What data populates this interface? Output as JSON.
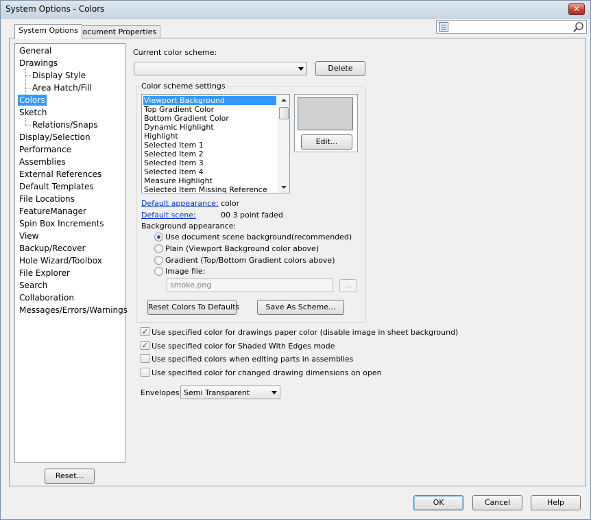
{
  "window": {
    "title": "System Options - Colors",
    "close_glyph": "✕"
  },
  "tabs": [
    {
      "label": "System Options"
    },
    {
      "label": "Document Properties"
    }
  ],
  "search": {
    "value": "",
    "icon": "search-icon"
  },
  "tree": {
    "items": [
      {
        "label": "General"
      },
      {
        "label": "Drawings"
      },
      {
        "label": "Display Style"
      },
      {
        "label": "Area Hatch/Fill"
      },
      {
        "label": "Colors"
      },
      {
        "label": "Sketch"
      },
      {
        "label": "Relations/Snaps"
      },
      {
        "label": "Display/Selection"
      },
      {
        "label": "Performance"
      },
      {
        "label": "Assemblies"
      },
      {
        "label": "External References"
      },
      {
        "label": "Default Templates"
      },
      {
        "label": "File Locations"
      },
      {
        "label": "FeatureManager"
      },
      {
        "label": "Spin Box Increments"
      },
      {
        "label": "View"
      },
      {
        "label": "Backup/Recover"
      },
      {
        "label": "Hole Wizard/Toolbox"
      },
      {
        "label": "File Explorer"
      },
      {
        "label": "Search"
      },
      {
        "label": "Collaboration"
      },
      {
        "label": "Messages/Errors/Warnings"
      }
    ],
    "selected": "Colors",
    "reset_label": "Reset..."
  },
  "color_scheme": {
    "current_label": "Current color scheme:",
    "current_value": "",
    "delete_label": "Delete"
  },
  "settings": {
    "group_title": "Color scheme settings",
    "list": [
      "Viewport Background",
      "Top Gradient Color",
      "Bottom Gradient Color",
      "Dynamic Highlight",
      "Highlight",
      "Selected Item 1",
      "Selected Item 2",
      "Selected Item 3",
      "Selected Item 4",
      "Measure Highlight",
      "Selected Item Missing Reference"
    ],
    "selected_item": "Viewport Background",
    "preview_color": "#d0d0d0",
    "edit_label": "Edit...",
    "default_appearance_label": "Default appearance:",
    "default_appearance_value": "color",
    "default_scene_label": "Default scene:",
    "default_scene_value": "00 3 point faded",
    "background_label": "Background appearance:",
    "bg_options": [
      {
        "label": "Use document scene background(recommended)",
        "checked": true
      },
      {
        "label": "Plain (Viewport Background color above)",
        "checked": false
      },
      {
        "label": "Gradient (Top/Bottom Gradient colors above)",
        "checked": false
      },
      {
        "label": "Image file:",
        "checked": false
      }
    ],
    "image_file_value": "smoke.png",
    "browse_label": "...",
    "reset_colors_label": "Reset Colors To Defaults",
    "save_scheme_label": "Save As Scheme..."
  },
  "checkboxes": [
    {
      "label": "Use specified color for drawings paper color (disable image in sheet background)",
      "checked": true
    },
    {
      "label": "Use specified color for Shaded With Edges mode",
      "checked": true
    },
    {
      "label": "Use specified colors when editing parts in assemblies",
      "checked": false
    },
    {
      "label": "Use specified color for changed drawing dimensions on open",
      "checked": false
    }
  ],
  "envelopes": {
    "label": "Envelopes:",
    "value": "Semi Transparent"
  },
  "footer": {
    "ok_label": "OK",
    "cancel_label": "Cancel",
    "help_label": "Help"
  }
}
